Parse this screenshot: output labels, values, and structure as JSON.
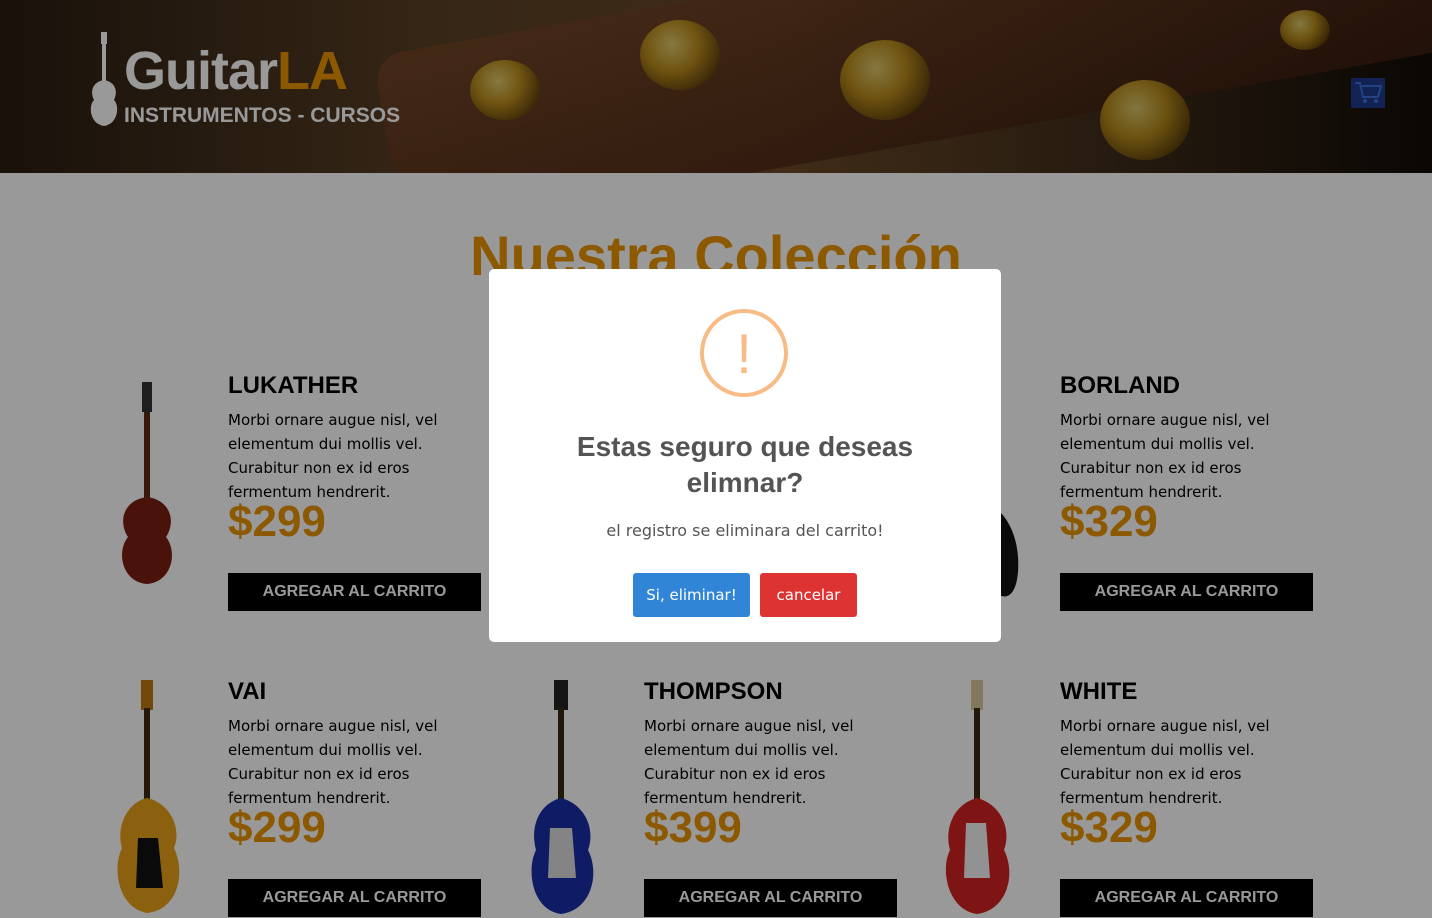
{
  "header": {
    "brand_main": "Guitar",
    "brand_accent": "LA",
    "tagline": "INSTRUMENTOS - CURSOS",
    "cart_icon": "shopping-cart-icon"
  },
  "main": {
    "title": "Nuestra Colección"
  },
  "products": [
    {
      "name": "LUKATHER",
      "description": "Morbi ornare augue nisl, vel elementum dui mollis vel. Curabitur non ex id eros fermentum hendrerit.",
      "price": "$299",
      "button": "AGREGAR AL CARRITO",
      "color": "#7a1f12"
    },
    {
      "name": "BORLAND",
      "description": "Morbi ornare augue nisl, vel elementum dui mollis vel. Curabitur non ex id eros fermentum hendrerit.",
      "price": "$329",
      "button": "AGREGAR AL CARRITO",
      "color": "#111111"
    },
    {
      "name": "VAI",
      "description": "Morbi ornare augue nisl, vel elementum dui mollis vel. Curabitur non ex id eros fermentum hendrerit.",
      "price": "$299",
      "button": "AGREGAR AL CARRITO",
      "color": "#e8a21a"
    },
    {
      "name": "THOMPSON",
      "description": "Morbi ornare augue nisl, vel elementum dui mollis vel. Curabitur non ex id eros fermentum hendrerit.",
      "price": "$399",
      "button": "AGREGAR AL CARRITO",
      "color": "#1a2fa8"
    },
    {
      "name": "WHITE",
      "description": "Morbi ornare augue nisl, vel elementum dui mollis vel. Curabitur non ex id eros fermentum hendrerit.",
      "price": "$329",
      "button": "AGREGAR AL CARRITO",
      "color": "#d42222"
    }
  ],
  "modal": {
    "icon": "!",
    "title": "Estas seguro que deseas elimnar?",
    "message": "el registro se eliminara del carrito!",
    "confirm_label": "Si, eliminar!",
    "cancel_label": "cancelar"
  },
  "colors": {
    "accent": "#e99401",
    "confirm": "#3085d6",
    "cancel": "#d33333",
    "warning": "#f8bb86"
  }
}
